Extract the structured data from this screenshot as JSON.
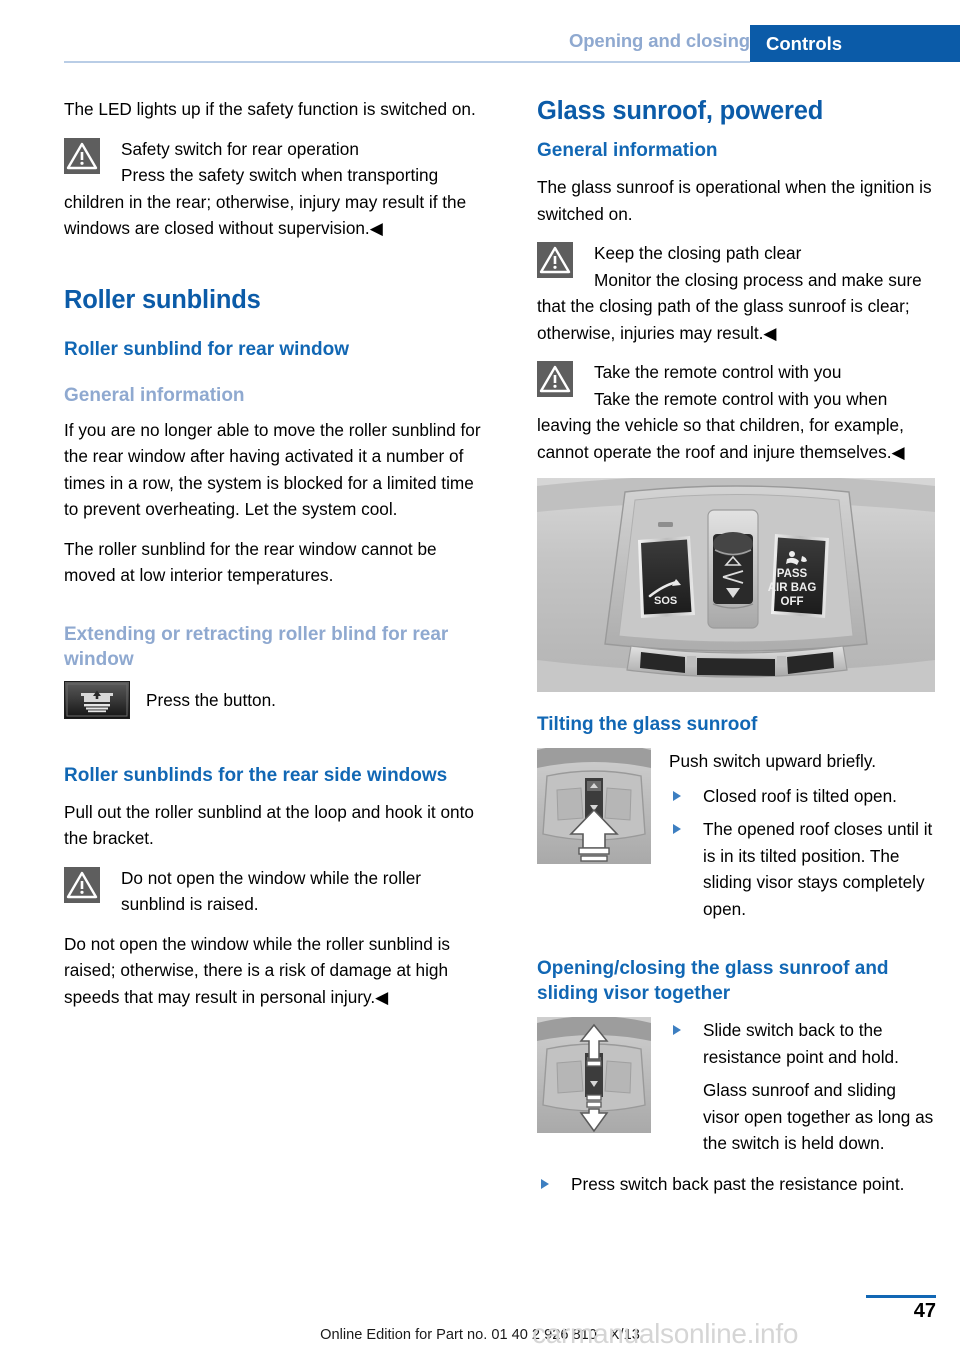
{
  "header": {
    "chapter": "Opening and closing",
    "section": "Controls"
  },
  "left_column": {
    "intro": "The LED lights up if the safety function is switched on.",
    "warning_1": {
      "icon": "warning-triangle-icon",
      "heading": "Safety switch for rear operation",
      "body": "Press the safety switch when transporting children in the rear; otherwise, injury may result if the windows are closed without supervision.◀"
    },
    "title": "Roller sunblinds",
    "sub_1": "Roller sunblind for rear window",
    "subsub_1": "General information",
    "para_1": "If you are no longer able to move the roller sunblind for the rear window after having activated it a number of times in a row, the system is blocked for a limited time to prevent overheating. Let the system cool.",
    "para_2": "The roller sunblind for the rear window cannot be moved at low interior temperatures.",
    "subsub_2": "Extending or retracting roller blind for rear window",
    "button_row": {
      "icon": "roller-sunblind-button-icon",
      "text": "Press the button."
    },
    "sub_2": "Roller sunblinds for the rear side windows",
    "para_3": "Pull out the roller sunblind at the loop and hook it onto the bracket.",
    "warning_2": {
      "icon": "warning-triangle-icon",
      "heading": "Do not open the window while the roller sunblind is raised."
    },
    "para_4": "Do not open the window while the roller sunblind is raised; otherwise, there is a risk of damage at high speeds that may result in personal injury.◀"
  },
  "right_column": {
    "title": "Glass sunroof, powered",
    "sub_1": "General information",
    "para_1": "The glass sunroof is operational when the ignition is switched on.",
    "warning_1": {
      "icon": "warning-triangle-icon",
      "heading": "Keep the closing path clear",
      "body": "Monitor the closing process and make sure that the closing path of the glass sunroof is clear; otherwise, injuries may result.◀"
    },
    "warning_2": {
      "icon": "warning-triangle-icon",
      "heading": "Take the remote control with you",
      "body": "Take the remote control with you when leaving the vehicle so that children, for example, cannot operate the roof and injure themselves.◀"
    },
    "figure_main": {
      "alt": "overhead-console-photo",
      "labels": [
        "SOS",
        "PASS",
        "AIR BAG",
        "OFF"
      ]
    },
    "sub_2": "Tilting the glass sunroof",
    "tilt": {
      "figure_alt": "sunroof-switch-push-up-thumbnail",
      "lead": "Push switch upward briefly.",
      "bullets": [
        "Closed roof is tilted open.",
        "The opened roof closes until it is in its tilted position. The sliding visor stays completely open."
      ]
    },
    "sub_3": "Opening/closing the glass sunroof and sliding visor together",
    "open_close": {
      "figure_alt": "sunroof-switch-slide-thumbnail",
      "bullets_in_figure": [
        "Slide switch back to the resistance point and hold."
      ],
      "note": "Glass sunroof and sliding visor open together as long as the switch is held down.",
      "bullets_after": [
        "Press switch back past the resistance point."
      ]
    }
  },
  "footer": {
    "page_number": "47",
    "edition_line": "Online Edition for Part no. 01 40 2 926 810 - X/13",
    "watermark": "carmanualsonline.info"
  },
  "colors": {
    "brand_blue": "#0b5ba8",
    "heading_blue": "#1167b4",
    "muted_blue": "#8fa9d0",
    "bullet_blue": "#3d7fc1",
    "warn_box": "#5e5e5e"
  }
}
